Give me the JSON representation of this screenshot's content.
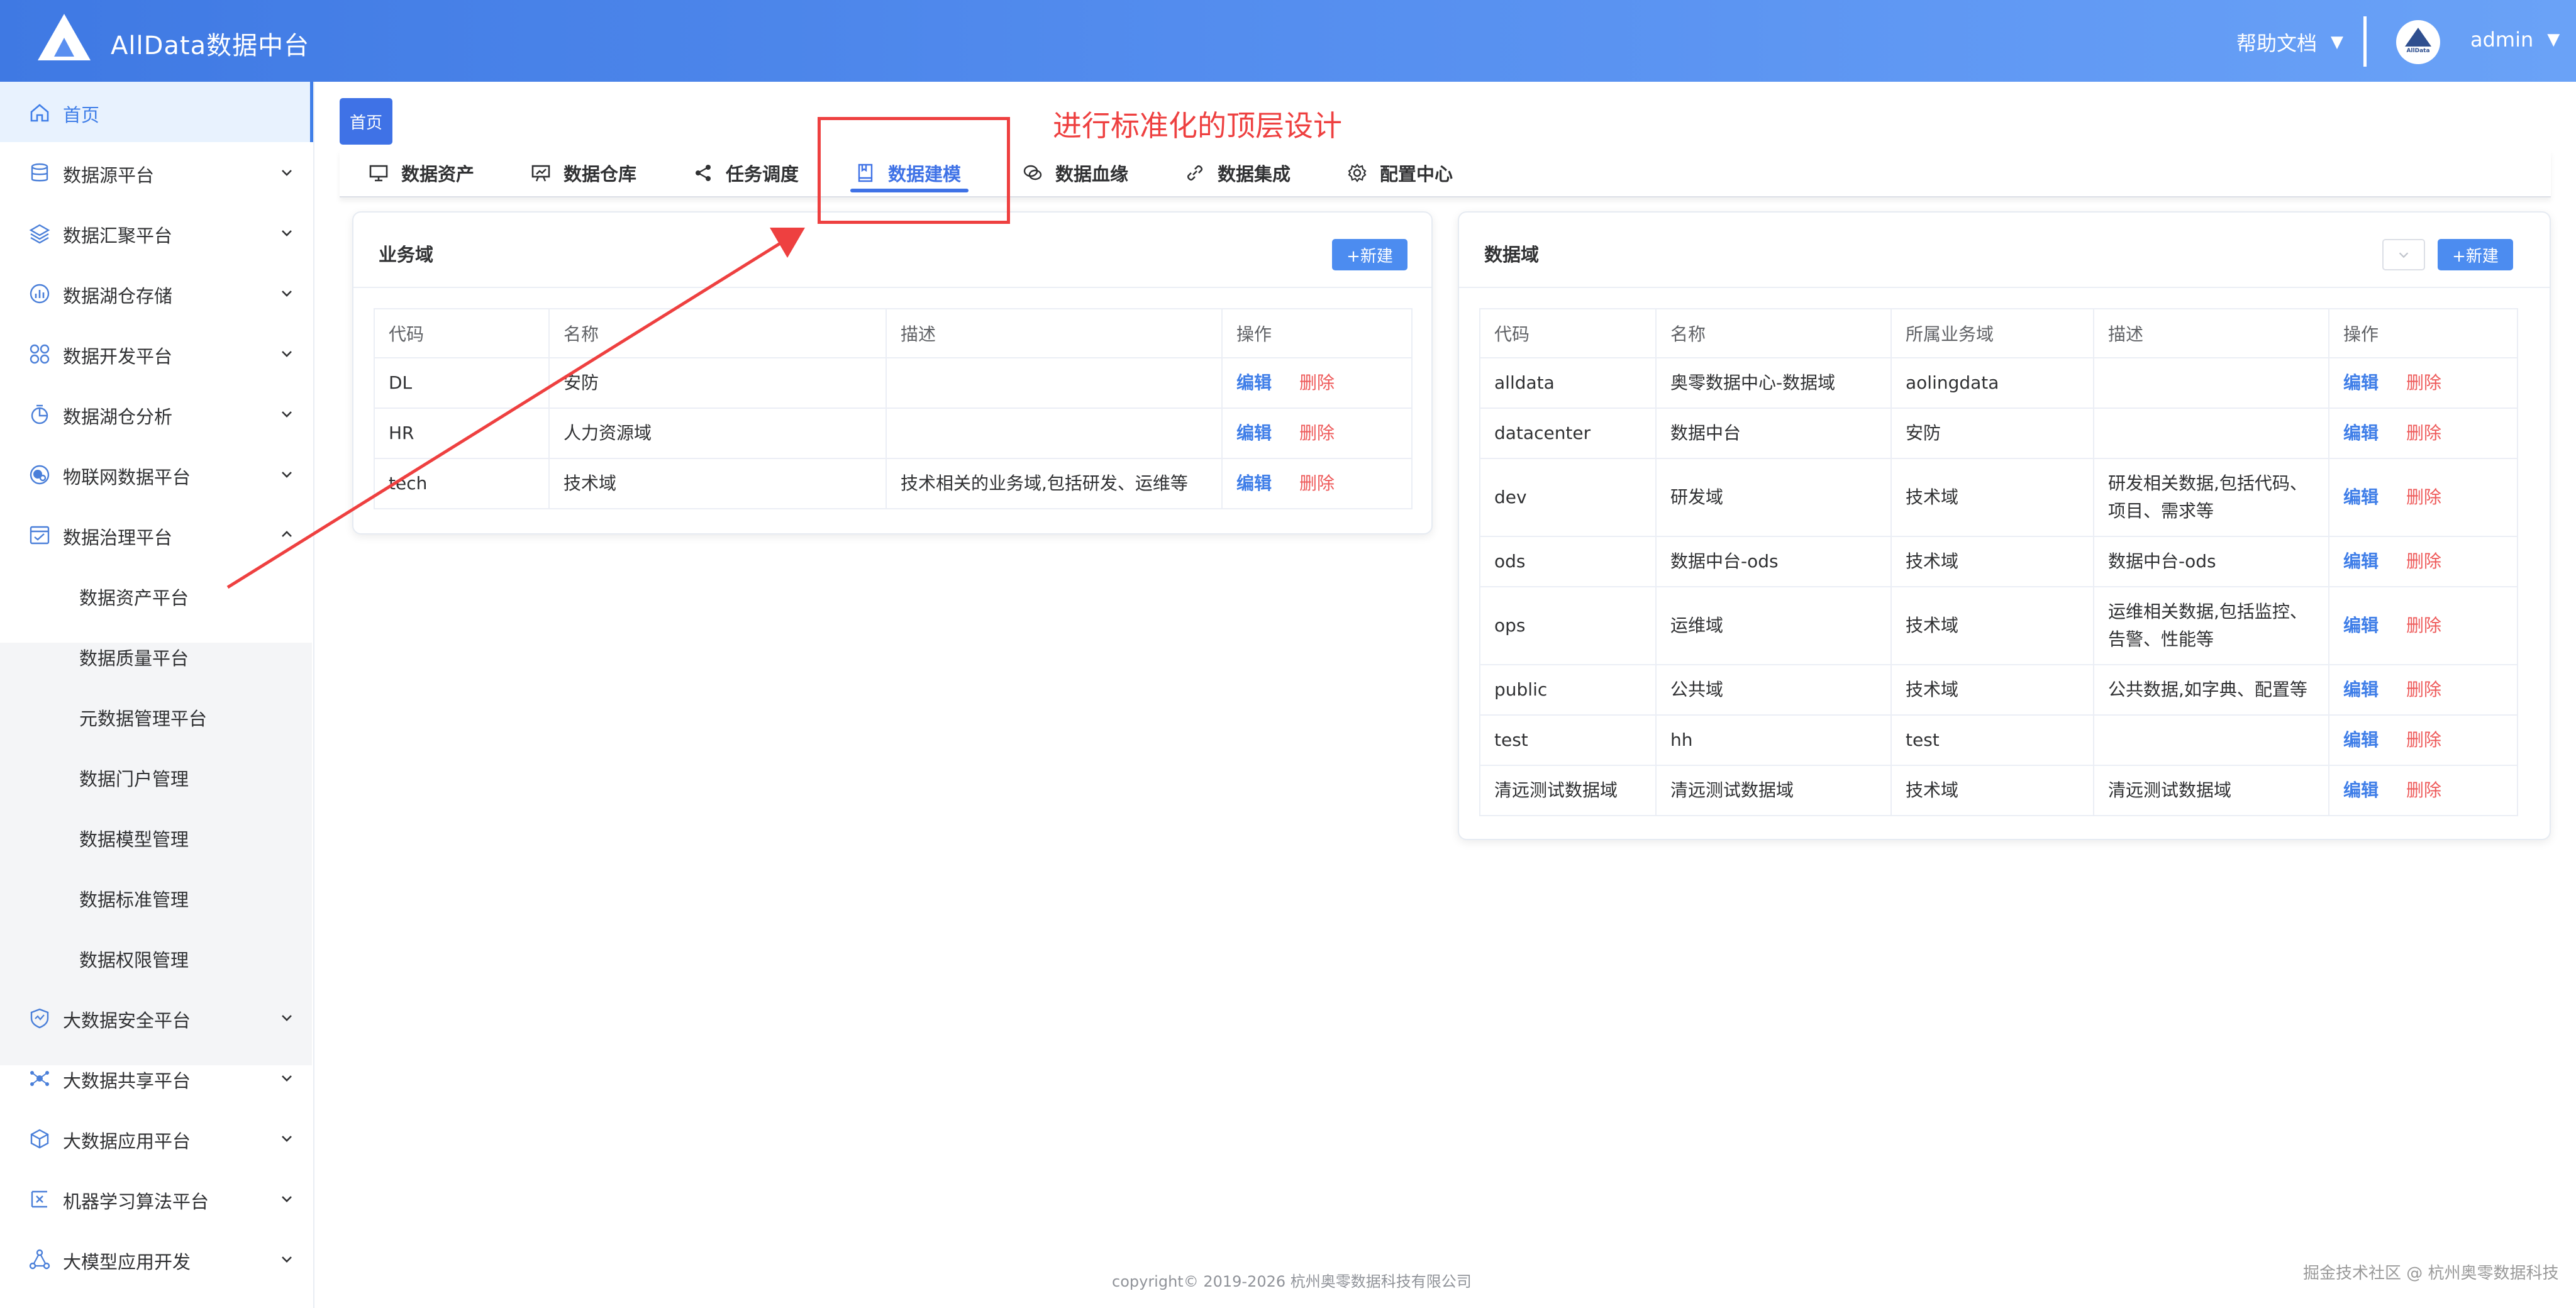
{
  "header": {
    "title": "AllData数据中台",
    "help": "帮助文档",
    "user": "admin",
    "avatar_text": "AllData"
  },
  "sidebar": {
    "items": [
      {
        "label": "首页",
        "icon": "home-icon"
      },
      {
        "label": "数据源平台",
        "icon": "database-icon"
      },
      {
        "label": "数据汇聚平台",
        "icon": "layers-icon"
      },
      {
        "label": "数据湖仓存储",
        "icon": "bar-chart-icon"
      },
      {
        "label": "数据开发平台",
        "icon": "grid-icon"
      },
      {
        "label": "数据湖仓分析",
        "icon": "pie-analysis-icon"
      },
      {
        "label": "物联网数据平台",
        "icon": "iot-icon"
      },
      {
        "label": "数据治理平台",
        "icon": "governance-icon"
      }
    ],
    "sub_items": [
      "数据资产平台",
      "数据质量平台",
      "元数据管理平台",
      "数据门户管理",
      "数据模型管理",
      "数据标准管理",
      "数据权限管理"
    ],
    "items_after": [
      {
        "label": "大数据安全平台",
        "icon": "shield-icon"
      },
      {
        "label": "大数据共享平台",
        "icon": "share-hub-icon"
      },
      {
        "label": "大数据应用平台",
        "icon": "cube-icon"
      },
      {
        "label": "机器学习算法平台",
        "icon": "ml-icon"
      },
      {
        "label": "大模型应用开发",
        "icon": "model-icon"
      }
    ]
  },
  "home_tag": "首页",
  "annotation": "进行标准化的顶层设计",
  "tabs": [
    "数据资产",
    "数据仓库",
    "任务调度",
    "数据建模",
    "数据血缘",
    "数据集成",
    "配置中心"
  ],
  "active_tab": "数据建模",
  "business_domain": {
    "title": "业务域",
    "new_label": "+新建",
    "columns": [
      "代码",
      "名称",
      "描述",
      "操作"
    ],
    "rows": [
      {
        "code": "DL",
        "name": "安防",
        "desc": ""
      },
      {
        "code": "HR",
        "name": "人力资源域",
        "desc": ""
      },
      {
        "code": "tech",
        "name": "技术域",
        "desc": "技术相关的业务域,包括研发、运维等"
      }
    ]
  },
  "data_domain": {
    "title": "数据域",
    "new_label": "+新建",
    "columns": [
      "代码",
      "名称",
      "所属业务域",
      "描述",
      "操作"
    ],
    "rows": [
      {
        "code": "alldata",
        "name": "奥零数据中心-数据域",
        "biz": "aolingdata",
        "desc": ""
      },
      {
        "code": "datacenter",
        "name": "数据中台",
        "biz": "安防",
        "desc": ""
      },
      {
        "code": "dev",
        "name": "研发域",
        "biz": "技术域",
        "desc": "研发相关数据,包括代码、项目、需求等"
      },
      {
        "code": "ods",
        "name": "数据中台-ods",
        "biz": "技术域",
        "desc": "数据中台-ods"
      },
      {
        "code": "ops",
        "name": "运维域",
        "biz": "技术域",
        "desc": "运维相关数据,包括监控、告警、性能等"
      },
      {
        "code": "public",
        "name": "公共域",
        "biz": "技术域",
        "desc": "公共数据,如字典、配置等"
      },
      {
        "code": "test",
        "name": "hh",
        "biz": "test",
        "desc": ""
      },
      {
        "code": "清远测试数据域",
        "name": "清远测试数据域",
        "biz": "技术域",
        "desc": "清远测试数据域"
      }
    ]
  },
  "actions": {
    "edit": "编辑",
    "delete": "删除"
  },
  "footer": "copyright© 2019-2026 杭州奥零数据科技有限公司",
  "watermark": "掘金技术社区 @ 杭州奥零数据科技",
  "colors": {
    "primary": "#3f72e6",
    "header": "#4f87ec",
    "danger": "#ee4040"
  }
}
